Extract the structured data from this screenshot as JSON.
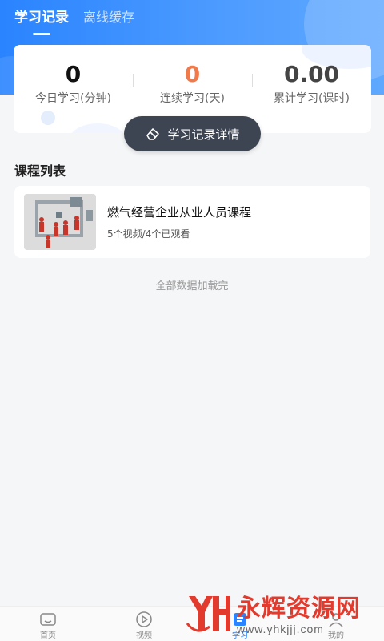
{
  "tabs": [
    {
      "label": "学习记录",
      "active": true
    },
    {
      "label": "离线缓存",
      "active": false
    }
  ],
  "stats": [
    {
      "value": "0",
      "label": "今日学习(分钟)",
      "color": "#111111"
    },
    {
      "value": "0",
      "label": "连续学习(天)",
      "color": "#f07a4a"
    },
    {
      "value": "0.00",
      "label": "累计学习(课时)",
      "color": "#444444"
    }
  ],
  "detail_button": {
    "label": "学习记录详情",
    "icon": "eraser-icon"
  },
  "course_section": {
    "title": "课程列表"
  },
  "courses": [
    {
      "title": "燃气经营企业从业人员课程",
      "meta": "5个视频/4个已观看"
    }
  ],
  "list_end_text": "全部数据加载完",
  "bottom_nav": [
    {
      "label": "首页",
      "icon": "home-icon",
      "active": false
    },
    {
      "label": "视频",
      "icon": "play-icon",
      "active": false
    },
    {
      "label": "学习",
      "icon": "study-icon",
      "active": true
    },
    {
      "label": "我的",
      "icon": "user-icon",
      "active": false
    }
  ],
  "watermark": {
    "name": "永辉资源网",
    "url": "www.yhkjjj.com"
  },
  "colors": {
    "primary": "#2a84ff",
    "accent_orange": "#f07a4a",
    "dark_button": "#3d4553"
  }
}
